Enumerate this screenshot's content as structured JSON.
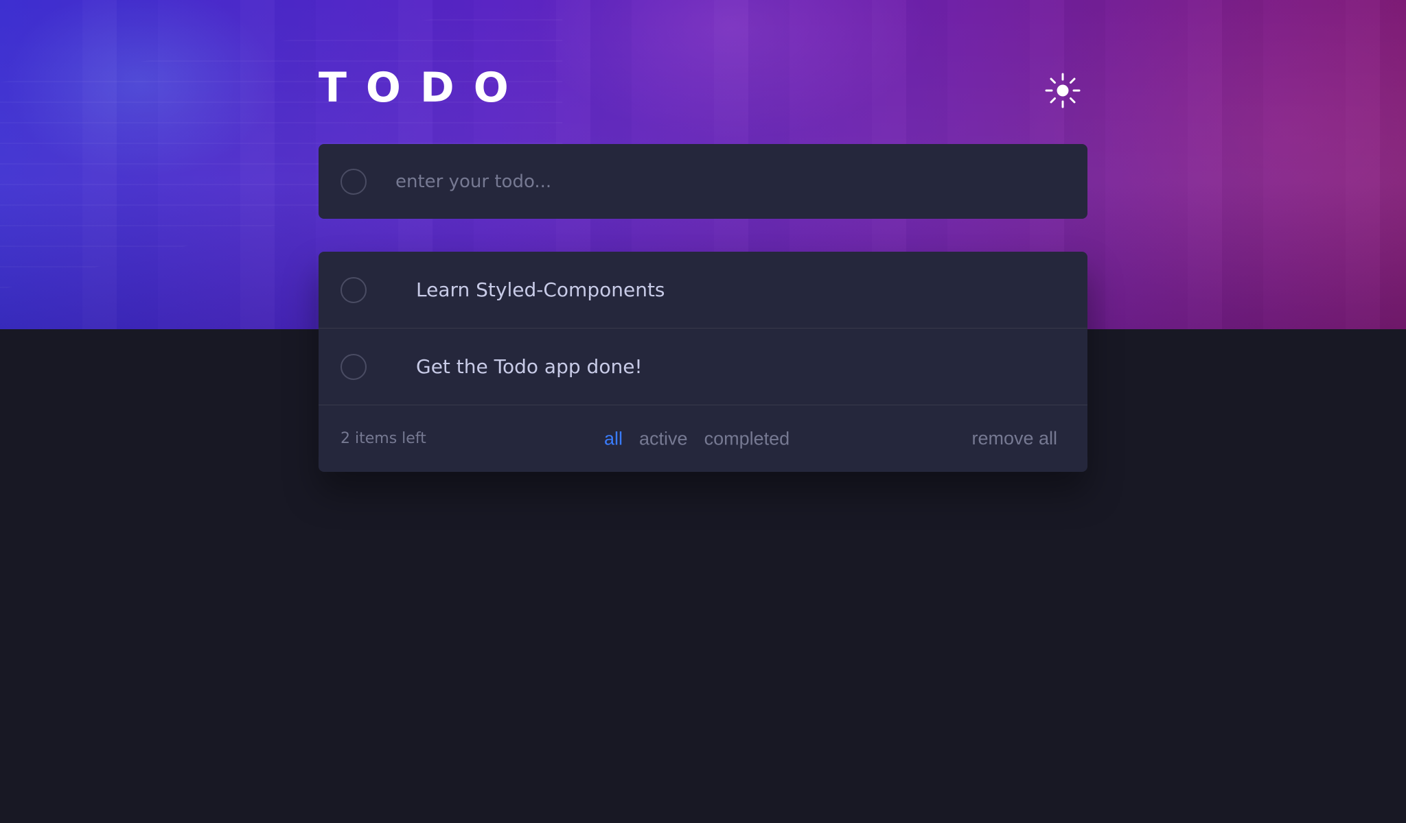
{
  "app": {
    "title": "TODO",
    "theme_icon": "sun-icon"
  },
  "new_todo": {
    "placeholder": "enter your todo..."
  },
  "todos": [
    {
      "text": "Learn Styled-Components",
      "completed": false
    },
    {
      "text": "Get the Todo app done!",
      "completed": false
    }
  ],
  "footer": {
    "items_left": "2 items left",
    "filters": [
      "all",
      "active",
      "completed"
    ],
    "active_filter": "all",
    "remove_all": "remove all"
  },
  "colors": {
    "background": "#181824",
    "card": "#25273c",
    "text": "#c8cbe7",
    "muted": "#767992",
    "accent": "#3a7cfd",
    "divider": "#393a4b"
  }
}
